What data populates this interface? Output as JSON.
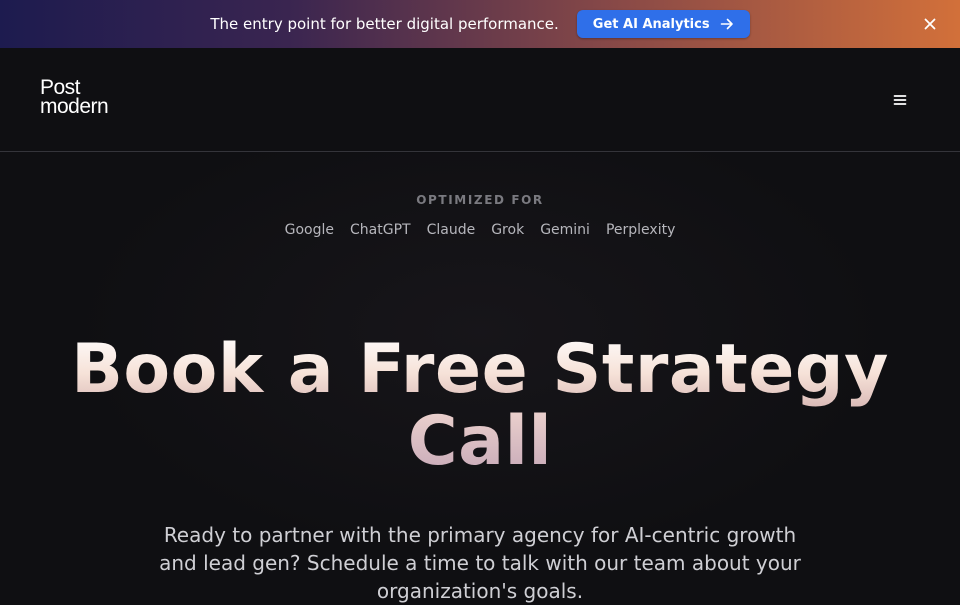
{
  "banner": {
    "text": "The entry point for better digital performance.",
    "cta_label": "Get AI Analytics",
    "cta_color": "#2f6fe9"
  },
  "header": {
    "logo_line1": "Post",
    "logo_line2": "modern"
  },
  "hero": {
    "optimized_label": "OPTIMIZED FOR",
    "platforms": [
      "Google",
      "ChatGPT",
      "Claude",
      "Grok",
      "Gemini",
      "Perplexity"
    ],
    "headline_line1": "Book a Free Strategy",
    "headline_line2": "Call",
    "subtext": "Ready to partner with the primary agency for AI-centric growth and lead gen? Schedule a time to talk with our team about your organization's goals."
  },
  "icons": {
    "cta": "arrow-right-icon",
    "close": "close-icon",
    "menu": "hamburger-menu-icon"
  }
}
